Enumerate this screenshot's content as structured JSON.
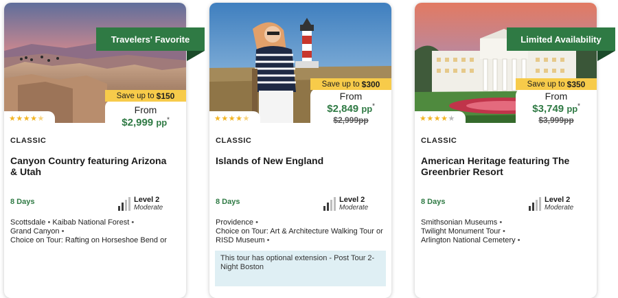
{
  "tours": [
    {
      "badge": "Travelers' Favorite",
      "save_prefix": "Save up to",
      "save_amount": "$150",
      "from": "From",
      "price": "$2,999",
      "pp": "pp",
      "asterisk": "*",
      "old_price": "",
      "rating": 4.5,
      "stars_full": "★★★★",
      "stars_half": "★",
      "stars_empty": "",
      "category": "CLASSIC",
      "title": "Canyon Country featuring Arizona & Utah",
      "days": "8 Days",
      "level": "Level 2",
      "level_desc": "Moderate",
      "stops": [
        "Scottsdale",
        "Kaibab National Forest",
        "Grand Canyon",
        "Choice on Tour: Rafting on Horseshoe Bend or"
      ],
      "extension": ""
    },
    {
      "badge": "",
      "save_prefix": "Save up to",
      "save_amount": "$300",
      "from": "From",
      "price": "$2,849",
      "pp": "pp",
      "asterisk": "*",
      "old_price": "$2,999pp",
      "rating": 4.5,
      "stars_full": "★★★★",
      "stars_half": "★",
      "stars_empty": "",
      "category": "CLASSIC",
      "title": "Islands of New England",
      "days": "8 Days",
      "level": "Level 2",
      "level_desc": "Moderate",
      "stops": [
        "Providence",
        "Choice on Tour: Art & Architecture Walking Tour or RISD Museum"
      ],
      "extension": "This tour has optional extension - Post Tour 2-Night Boston"
    },
    {
      "badge": "Limited Availability",
      "save_prefix": "Save up to",
      "save_amount": "$350",
      "from": "From",
      "price": "$3,749",
      "pp": "pp",
      "asterisk": "*",
      "old_price": "$3,999pp",
      "rating": 4,
      "stars_full": "★★★★",
      "stars_half": "",
      "stars_empty": "★",
      "category": "CLASSIC",
      "title": "American Heritage featuring The Greenbrier Resort",
      "days": "8 Days",
      "level": "Level 2",
      "level_desc": "Moderate",
      "stops": [
        "Smithsonian Museums",
        "Twilight Monument Tour",
        "Arlington National Cemetery"
      ],
      "extension": ""
    }
  ],
  "colors": {
    "brand_green": "#2f7a44",
    "save_yellow": "#f7cb4a",
    "star_gold": "#f2b422",
    "extension_bg": "#dfeff4"
  }
}
